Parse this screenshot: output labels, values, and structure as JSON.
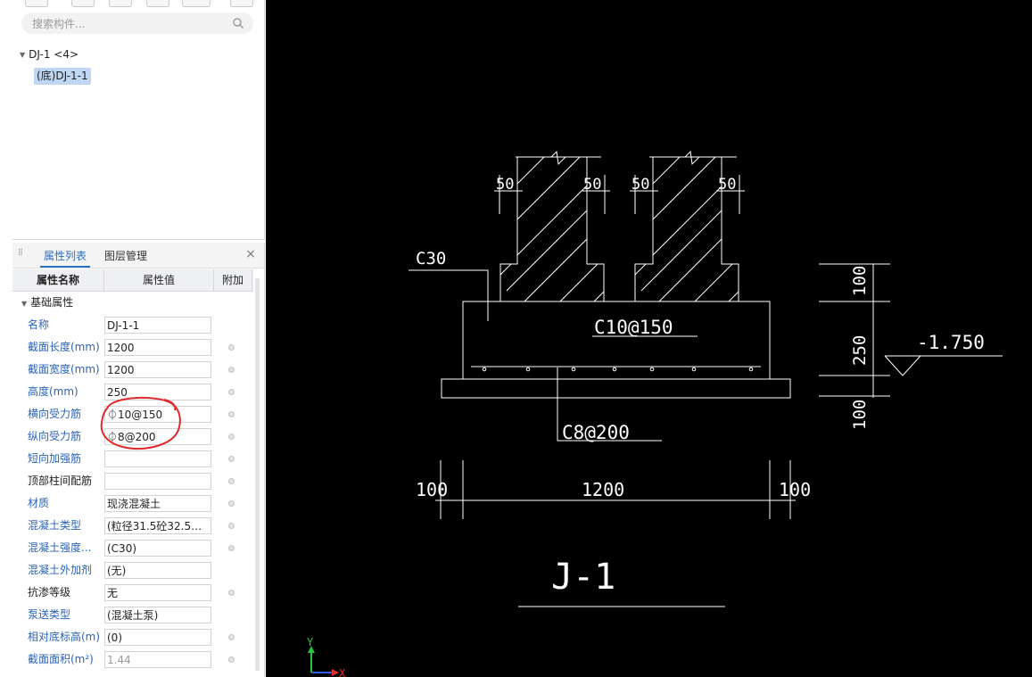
{
  "search": {
    "placeholder": "搜索构件..."
  },
  "tree": {
    "root_label": "DJ-1 <4>",
    "child_label": "(底)DJ-1-1"
  },
  "tabs": {
    "props": "属性列表",
    "layers": "图层管理"
  },
  "grid": {
    "col_name": "属性名称",
    "col_value": "属性值",
    "col_extra": "附加",
    "group": "基础属性",
    "rows": [
      {
        "name": "名称",
        "value": "DJ-1-1"
      },
      {
        "name": "截面长度(mm)",
        "value": "1200"
      },
      {
        "name": "截面宽度(mm)",
        "value": "1200"
      },
      {
        "name": "高度(mm)",
        "value": "250"
      },
      {
        "name": "横向受力筋",
        "value": "⏀10@150"
      },
      {
        "name": "纵向受力筋",
        "value": "⏀8@200"
      },
      {
        "name": "短向加强筋",
        "value": ""
      },
      {
        "name": "顶部柱间配筋",
        "value": ""
      },
      {
        "name": "材质",
        "value": "现浇混凝土"
      },
      {
        "name": "混凝土类型",
        "value": "(粒径31.5砼32.5级..."
      },
      {
        "name": "混凝土强度...",
        "value": "(C30)"
      },
      {
        "name": "混凝土外加剂",
        "value": "(无)"
      },
      {
        "name": "抗渗等级",
        "value": "无"
      },
      {
        "name": "泵送类型",
        "value": "(混凝土泵)"
      },
      {
        "name": "相对底标高(m)",
        "value": "(0)"
      },
      {
        "name": "截面面积(m²)",
        "value": "1.44"
      }
    ]
  },
  "drawing": {
    "dim_50_1": "50",
    "dim_50_2": "50",
    "dim_50_3": "50",
    "dim_50_4": "50",
    "concrete": "C30",
    "top_bar": "C10@150",
    "bottom_bar": "C8@200",
    "elev_100_top": "100",
    "elev_250": "250",
    "elev_100_bot": "100",
    "level": "-1.750",
    "width_left": "100",
    "width_total": "1200",
    "width_right": "100",
    "title": "J-1",
    "axis_y": "Y",
    "axis_x": "X"
  },
  "colors": {
    "cad_line": "#ffffff",
    "annotation": "#e0282a",
    "tab_active": "#2a6fc4"
  }
}
